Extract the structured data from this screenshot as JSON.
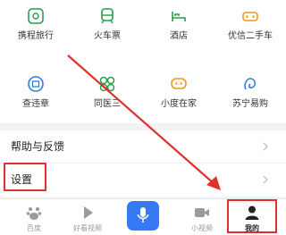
{
  "grid": {
    "row1": [
      {
        "label": "携程旅行",
        "icon": "travel-icon",
        "color": "#2a9d4b"
      },
      {
        "label": "火车票",
        "icon": "train-icon",
        "color": "#2a9d4b"
      },
      {
        "label": "酒店",
        "icon": "hotel-icon",
        "color": "#2a9d4b"
      },
      {
        "label": "优信二手车",
        "icon": "car-icon",
        "color": "#e89a1b"
      }
    ],
    "row2": [
      {
        "label": "查违章",
        "icon": "violation-icon",
        "color": "#2f7de1"
      },
      {
        "label": "同医三",
        "icon": "medical-icon",
        "color": "#2a9d4b"
      },
      {
        "label": "小度在家",
        "icon": "xiaodu-icon",
        "color": "#e89a1b"
      },
      {
        "label": "苏宁易购",
        "icon": "suning-icon",
        "color": "#2f7de1"
      }
    ]
  },
  "list": {
    "help_label": "帮助与反馈",
    "settings_label": "设置"
  },
  "tabbar": {
    "tabs": [
      {
        "label": "百度",
        "icon": "baidu-paw-icon"
      },
      {
        "label": "好看视频",
        "icon": "play-icon"
      },
      {
        "label": "",
        "icon": "microphone-icon"
      },
      {
        "label": "小视频",
        "icon": "video-camera-icon"
      },
      {
        "label": "我的",
        "icon": "user-icon"
      }
    ],
    "active_index": 4
  },
  "colors": {
    "accent_blue": "#3778f4",
    "annotation_red": "#e0302b"
  }
}
